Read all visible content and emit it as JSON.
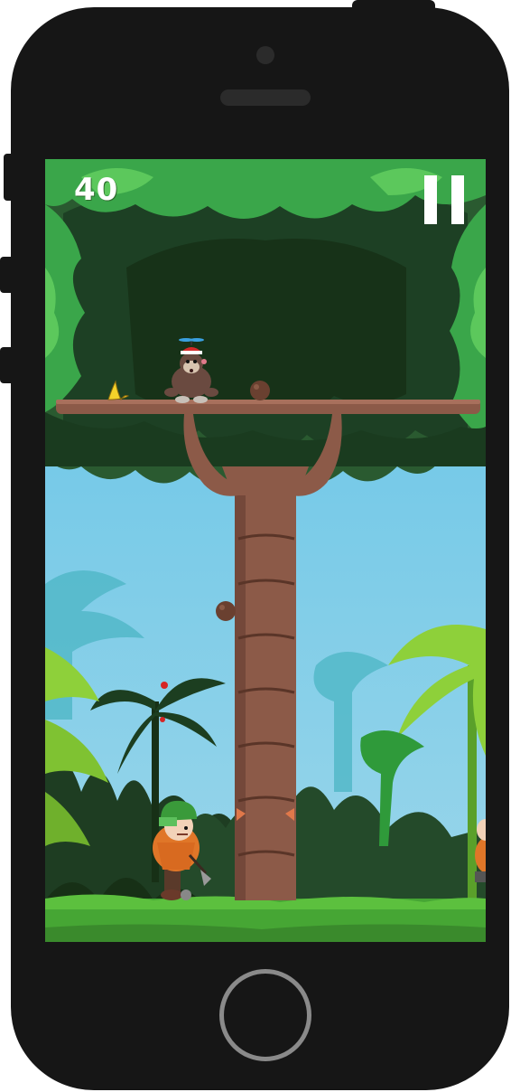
{
  "hud": {
    "score": "40",
    "pause_icon": "pause-icon"
  },
  "colors": {
    "phone_body": "#161616",
    "sky_top": "#5fc2e6",
    "sky_bottom": "#8ed0e8",
    "canopy_light": "#3daa4a",
    "canopy_dark": "#1f4a2a",
    "trunk": "#8a5a46",
    "ground": "#4aaa3a"
  },
  "sprites": {
    "player": "monkey-with-propeller-cap",
    "banana": "banana-peel-icon",
    "coconut": "coconut-icon",
    "enemy": "lumberjack-with-axe"
  }
}
